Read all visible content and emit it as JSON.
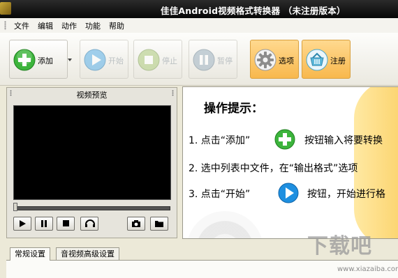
{
  "window": {
    "title": "佳佳Android视频格式转换器 （未注册版本）"
  },
  "menu": [
    "文件",
    "编辑",
    "动作",
    "功能",
    "帮助"
  ],
  "toolbar": {
    "add": "添加",
    "start": "开始",
    "stop": "停止",
    "pause": "暂停",
    "options": "选项",
    "register": "注册"
  },
  "preview": {
    "title": "视频预览"
  },
  "tips": {
    "title": "操作提示：",
    "line1_a": "1. 点击“添加”",
    "line1_b": "按钮输入将要转换",
    "line2": "2. 选中列表中文件，在“输出格式”选项",
    "line3_a": "3. 点击“开始”",
    "line3_b": "按钮，开始进行格"
  },
  "tabs": [
    "常规设置",
    "音视频高级设置"
  ],
  "watermark": {
    "main": "下载吧",
    "url": "www.xiazaiba.com"
  },
  "colors": {
    "accent_green": "#3cb43c",
    "accent_blue": "#1e8fe0",
    "highlight": "#f8b84d"
  }
}
